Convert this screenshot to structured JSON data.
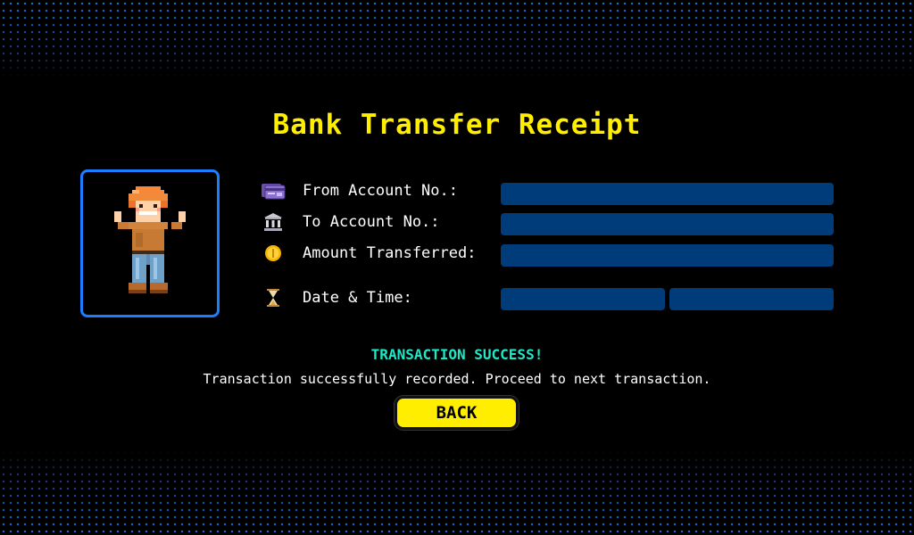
{
  "receipt": {
    "title": "Bank Transfer Receipt"
  },
  "fields": [
    {
      "label": "From Account No.:",
      "icon": "credit-card-icon",
      "value": ""
    },
    {
      "label": "To Account No.:",
      "icon": "bank-icon",
      "value": ""
    },
    {
      "label": "Amount Transferred:",
      "icon": "coin-icon",
      "value": ""
    },
    {
      "label": "Date & Time:",
      "icon": "hourglass-icon",
      "date_value": "",
      "time_value": ""
    }
  ],
  "status": {
    "headline": "TRANSACTION SUCCESS!",
    "message": "Transaction successfully recorded. Proceed to next transaction."
  },
  "actions": {
    "back_label": "BACK"
  },
  "colors": {
    "title": "#ffee00",
    "field_bg": "#003c7a",
    "avatar_border": "#1e7cff",
    "success": "#1de9c8",
    "button": "#ffee00",
    "dots": "#1f6fe0"
  }
}
